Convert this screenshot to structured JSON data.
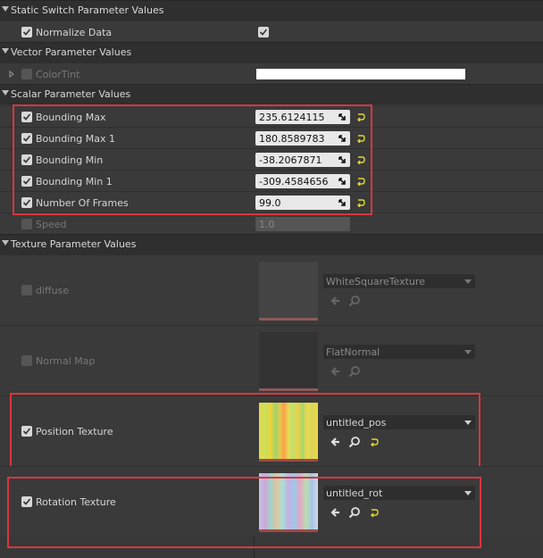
{
  "categories": {
    "static_switch": "Static Switch Parameter Values",
    "vector": "Vector Parameter Values",
    "scalar": "Scalar Parameter Values",
    "texture": "Texture Parameter Values"
  },
  "static_switch": {
    "normalize_label": "Normalize Data",
    "normalize_checked": true,
    "value_checked": true
  },
  "vector": {
    "color_tint_label": "ColorTint",
    "color_tint_value": "#ffffff"
  },
  "scalar": {
    "rows": [
      {
        "label": "Bounding Max",
        "value": "235.6124115"
      },
      {
        "label": "Bounding Max 1",
        "value": "180.8589783"
      },
      {
        "label": "Bounding Min",
        "value": "-38.2067871"
      },
      {
        "label": "Bounding Min 1",
        "value": "-309.4584656"
      },
      {
        "label": "Number Of Frames",
        "value": "99.0"
      }
    ],
    "speed": {
      "label": "Speed",
      "value": "1.0"
    }
  },
  "texture": {
    "diffuse": {
      "label": "diffuse",
      "asset": "WhiteSquareTexture"
    },
    "normal": {
      "label": "Normal Map",
      "asset": "FlatNormal"
    },
    "position": {
      "label": "Position Texture",
      "asset": "untitled_pos"
    },
    "rotation": {
      "label": "Rotation Texture",
      "asset": "untitled_rot"
    }
  },
  "colors": {
    "highlight": "#d9363e",
    "reset_arrow": "#e2d43a"
  }
}
